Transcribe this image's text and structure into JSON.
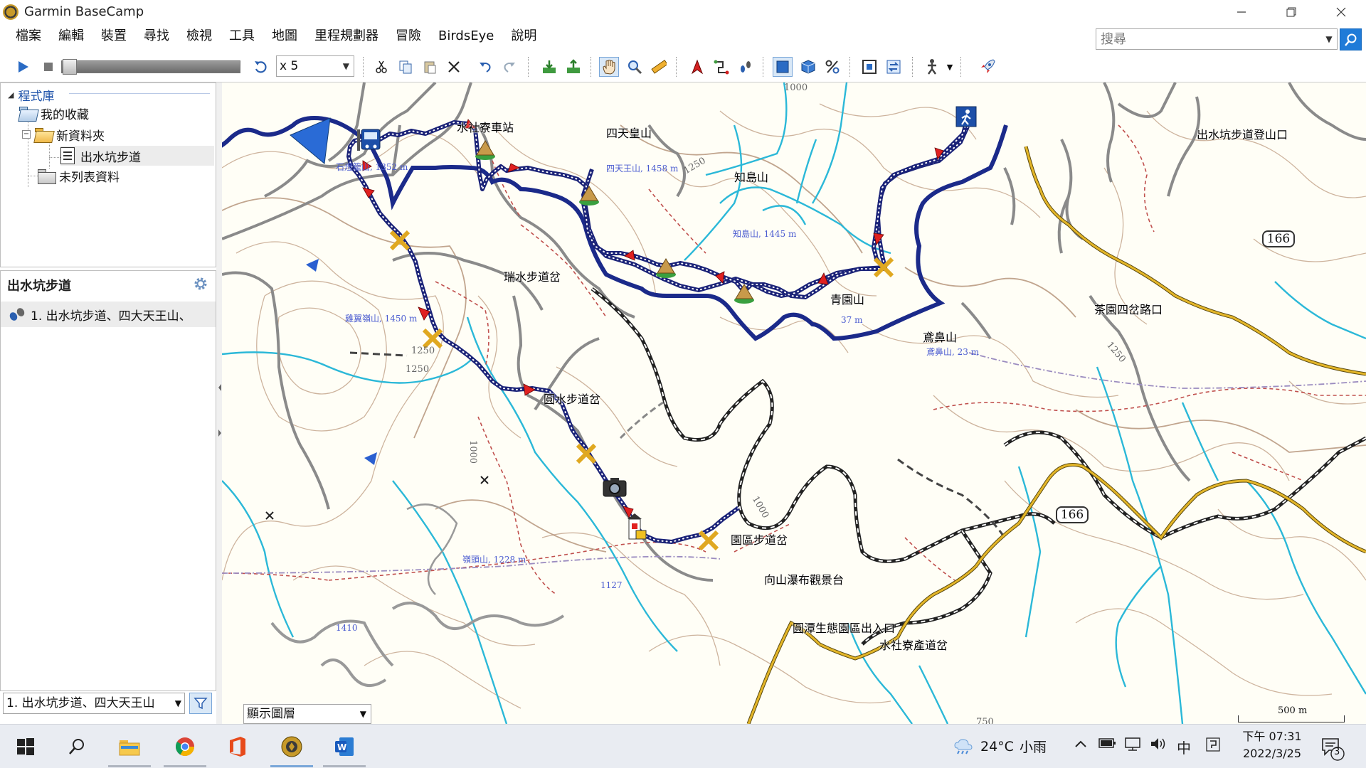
{
  "window": {
    "title": "Garmin BaseCamp"
  },
  "menu": [
    "檔案",
    "編輯",
    "裝置",
    "尋找",
    "檢視",
    "工具",
    "地圖",
    "里程規劃器",
    "冒險",
    "BirdsEye",
    "說明"
  ],
  "search": {
    "placeholder": "搜尋"
  },
  "toolbar": {
    "speed": "x 5"
  },
  "library": {
    "header": "程式庫",
    "tree": [
      {
        "label": "我的收藏"
      },
      {
        "label": "新資料夾"
      },
      {
        "label": "出水坑步道"
      },
      {
        "label": "未列表資料"
      }
    ]
  },
  "list": {
    "title": "出水坑步道",
    "items": [
      "1. 出水坑步道、四大天王山、"
    ],
    "filter_value": "1. 出水坑步道、四大天王山"
  },
  "map": {
    "layer_select": "顯示圖層",
    "scale": "500 m",
    "route_badges": [
      "166",
      "166"
    ],
    "labels": [
      "水社寮車站",
      "四天皇山",
      "知島山",
      "瑞水步道岔",
      "青園山",
      "鳶鼻山",
      "茶園四岔路口",
      "出水坑步道登山口",
      "圓水步道岔",
      "園區步道岔",
      "向山瀑布觀景台",
      "圓潭生態園區出入口",
      "水社寮產道岔"
    ],
    "elevations": [
      "石燈籠山, 1352 m",
      "四天王山, 1458 m",
      "知島山, 1445 m",
      "37 m",
      "鳶鼻山, 23 m",
      "雞翼嶺山, 1450 m",
      "嶺頭山, 1228 m",
      "1127",
      "1410"
    ],
    "contours": [
      "1000",
      "1250",
      "1250",
      "1250",
      "1000",
      "1000",
      "1250",
      "750"
    ]
  },
  "taskbar": {
    "weather_temp": "24°C",
    "weather_text": "小雨",
    "ime": "中",
    "time": "下午 07:31",
    "date": "2022/3/25",
    "notifications": "3"
  }
}
